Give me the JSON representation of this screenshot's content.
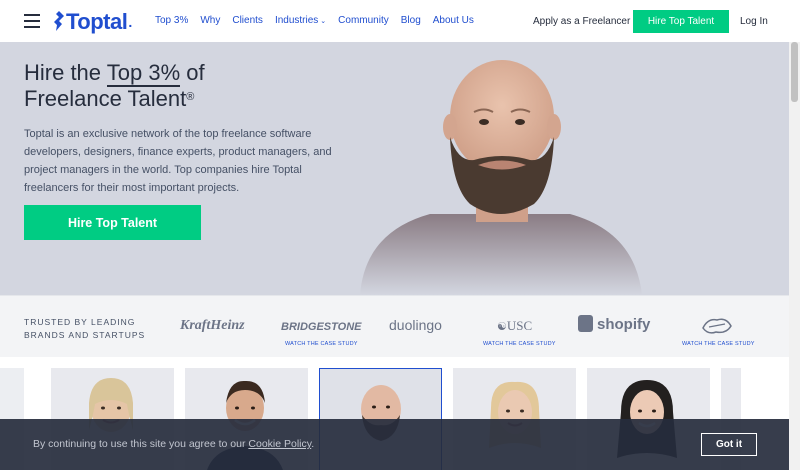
{
  "header": {
    "logo_text": "Toptal",
    "nav": [
      {
        "label": "Top 3%"
      },
      {
        "label": "Why"
      },
      {
        "label": "Clients"
      },
      {
        "label": "Industries"
      },
      {
        "label": "Community"
      },
      {
        "label": "Blog"
      },
      {
        "label": "About Us"
      }
    ],
    "apply_label": "Apply as a Freelancer",
    "hire_label": "Hire Top Talent",
    "login_label": "Log In"
  },
  "hero": {
    "title_prefix": "Hire the ",
    "title_highlight": "Top 3%",
    "title_suffix": " of",
    "title_line2": "Freelance Talent",
    "registered": "®",
    "description": "Toptal is an exclusive network of the top freelance software developers, designers, finance experts, product managers, and project managers in the world. Top companies hire Toptal freelancers for their most important projects.",
    "cta_label": "Hire Top Talent"
  },
  "trusted": {
    "line1": "TRUSTED BY LEADING",
    "line2": "BRANDS AND STARTUPS",
    "brands": [
      {
        "name": "KraftHeinz"
      },
      {
        "name": "BRIDGESTONE",
        "case_study": "WATCH THE CASE STUDY"
      },
      {
        "name": "duolingo"
      },
      {
        "name": "USC",
        "case_study": "WATCH THE CASE STUDY"
      },
      {
        "name": "shopify"
      },
      {
        "name": "Cavaliers",
        "case_study": "WATCH THE CASE STUDY"
      }
    ]
  },
  "cookie": {
    "text_prefix": "By continuing to use this site you agree to our ",
    "link_text": "Cookie Policy",
    "text_suffix": ".",
    "button_label": "Got it"
  },
  "colors": {
    "brand_blue": "#204ecf",
    "cta_green": "#00cc83",
    "hero_bg": "#d3d6e0",
    "dark_text": "#262d3d"
  }
}
